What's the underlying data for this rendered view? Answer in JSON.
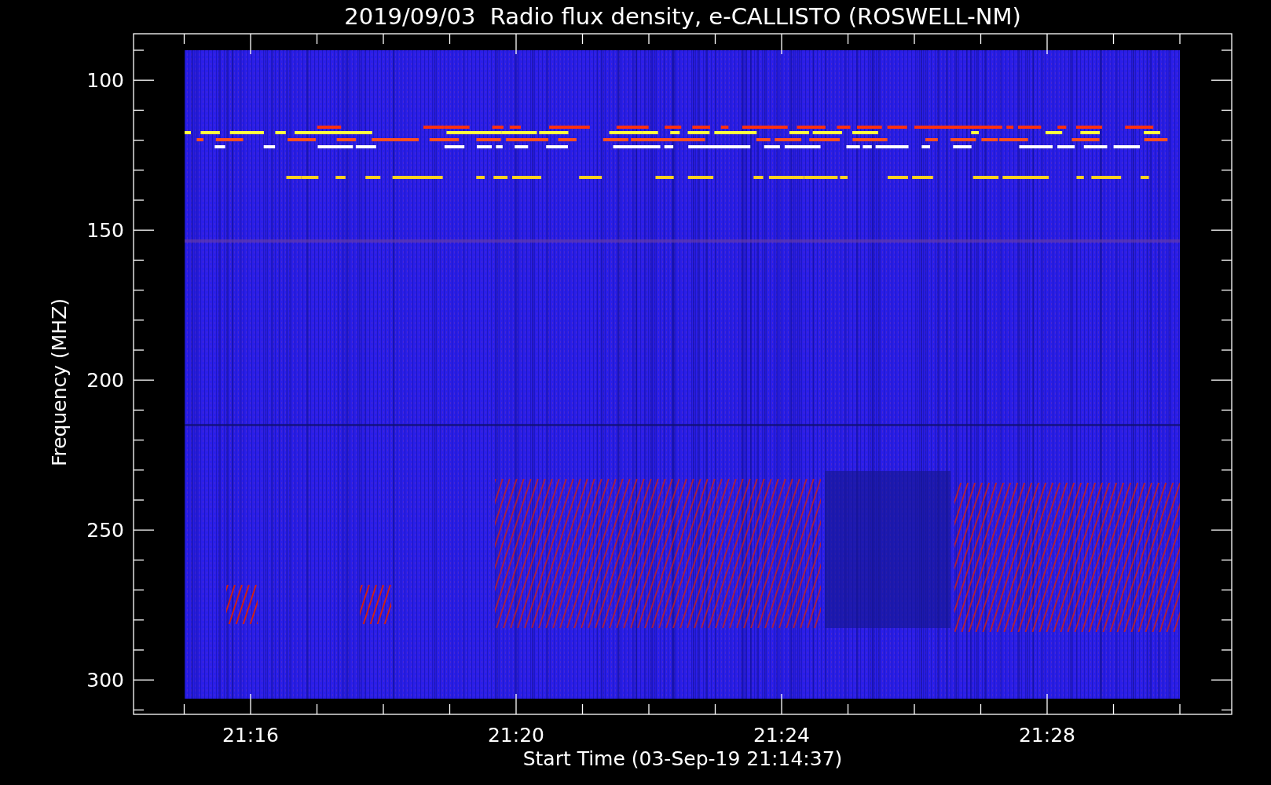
{
  "title": "2019/09/03  Radio flux density, e-CALLISTO (ROSWELL-NM)",
  "y_axis": {
    "label": "Frequency (MHZ)",
    "ticks": [
      "100",
      "150",
      "200",
      "250",
      "300"
    ]
  },
  "x_axis": {
    "label": "Start Time (03-Sep-19 21:14:37)",
    "ticks": [
      "21:16",
      "21:20",
      "21:24",
      "21:28"
    ]
  }
}
